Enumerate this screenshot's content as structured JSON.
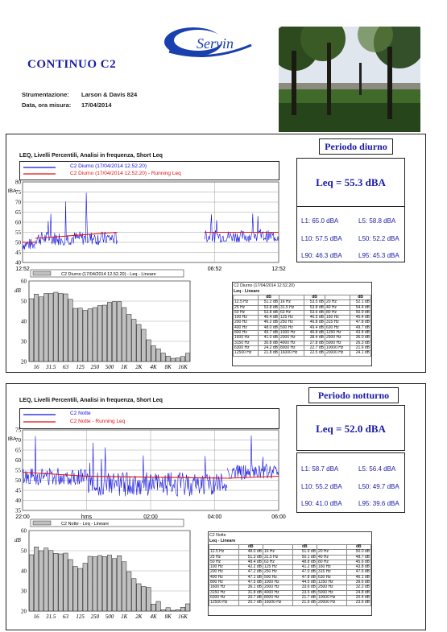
{
  "doc": {
    "title": "CONTINUO C2",
    "instrument_label": "Strumentazione:",
    "instrument_value": "Larson & Davis 824",
    "date_label": "Data, ora misura:",
    "date_value": "17/04/2014",
    "logo_text": "Servin"
  },
  "day": {
    "section_title": "LEQ, Livelli Percentili, Analisi in frequenza, Short Leq",
    "period_label": "Periodo diurno",
    "leq": "Leq = 55.3 dBA",
    "l1": "L1: 65.0 dBA",
    "l5": "L5: 58.8 dBA",
    "l10": "L10: 57.5 dBA",
    "l50": "L50: 52.2 dBA",
    "l90": "L90: 46.3 dBA",
    "l95": "L95: 45.3 dBA",
    "legend1": "C2 Diurno (17/04/2014 12.52.20)",
    "legend2": "C2 Diurno (17/04/2014 12.52.20) - Running Leq",
    "ts_ylabel": "dBA",
    "ts_yticks": [
      "80",
      "75",
      "70",
      "65",
      "60",
      "55",
      "50",
      "45",
      "40"
    ],
    "ts_xticks": [
      "12:52",
      "06:52",
      "12:52"
    ],
    "spec_legend": "C2 Diurno (17/04/2014 12.52.20) - Leq - Lineare",
    "spec_ylabel": "dB",
    "spec_yticks": [
      "60",
      "50",
      "40",
      "30",
      "20"
    ],
    "spec_xticks": [
      "16",
      "31.5",
      "63",
      "125",
      "250",
      "500",
      "1K",
      "2K",
      "4K",
      "8K",
      "16K"
    ],
    "table_title": "C2 Diurno (17/04/2014 12.52.20)",
    "table_sub": "Leq - Lineare",
    "table_rows": [
      [
        "12.5 Hz",
        "51.2 dB",
        "16 Hz",
        "53.5 dB",
        "20 Hz",
        "52.1 dB"
      ],
      [
        "25 Hz",
        "53.8 dB",
        "31.5 Hz",
        "53.8 dB",
        "40 Hz",
        "54.4 dB"
      ],
      [
        "50 Hz",
        "53.8 dB",
        "63 Hz",
        "53.6 dB",
        "80 Hz",
        "50.9 dB"
      ],
      [
        "100 Hz",
        "46.4 dB",
        "125 Hz",
        "46.5 dB",
        "160 Hz",
        "45.4 dB"
      ],
      [
        "200 Hz",
        "46.2 dB",
        "250 Hz",
        "46.8 dB",
        "315 Hz",
        "47.8 dB"
      ],
      [
        "400 Hz",
        "48.0 dB",
        "500 Hz",
        "49.4 dB",
        "630 Hz",
        "49.7 dB"
      ],
      [
        "800 Hz",
        "49.7 dB",
        "1000 Hz",
        "46.8 dB",
        "1250 Hz",
        "43.4 dB"
      ],
      [
        "1600 Hz",
        "41.0 dB",
        "2000 Hz",
        "38.4 dB",
        "2500 Hz",
        "36.0 dB"
      ],
      [
        "3150 Hz",
        "30.8 dB",
        "4000 Hz",
        "27.8 dB",
        "5000 Hz",
        "26.3 dB"
      ],
      [
        "6300 Hz",
        "24.2 dB",
        "8000 Hz",
        "22.7 dB",
        "10000 Hz",
        "21.6 dB"
      ],
      [
        "12500 Hz",
        "21.8 dB",
        "16000 Hz",
        "22.5 dB",
        "20000 Hz",
        "24.1 dB"
      ]
    ]
  },
  "night": {
    "section_title": "LEQ, Livelli Percentili, Analisi in frequenza, Short Leq",
    "period_label": "Periodo notturno",
    "leq": "Leq = 52.0 dBA",
    "l1": "L1: 58.7 dBA",
    "l5": "L5: 56.4 dBA",
    "l10": "L10: 55.2 dBA",
    "l50": "L50: 49.7 dBA",
    "l90": "L90: 41.0 dBA",
    "l95": "L95: 39.6 dBA",
    "legend1": "C2 Notte",
    "legend2": "C2 Notte - Running Leq",
    "ts_ylabel": "dBA",
    "ts_yticks": [
      "75",
      "70",
      "65",
      "60",
      "55",
      "50",
      "45",
      "40",
      "35"
    ],
    "ts_xticks": [
      "22:00",
      "hms",
      "02:00",
      "04:00",
      "06:00"
    ],
    "spec_legend": "C2 Notte - Leq - Lineare",
    "spec_ylabel": "dB",
    "spec_yticks": [
      "60",
      "50",
      "40",
      "30",
      "20"
    ],
    "spec_xticks": [
      "16",
      "31.5",
      "63",
      "125",
      "250",
      "500",
      "1K",
      "2K",
      "4K",
      "8K",
      "16K"
    ],
    "table_title": "C2 Notte",
    "table_sub": "Leq - Lineare",
    "table_rows": [
      [
        "12.5 Hz",
        "48.0 dB",
        "16 Hz",
        "51.9 dB",
        "20 Hz",
        "50.0 dB"
      ],
      [
        "25 Hz",
        "51.3 dB",
        "31.5 Hz",
        "50.1 dB",
        "40 Hz",
        "48.7 dB"
      ],
      [
        "50 Hz",
        "48.4 dB",
        "63 Hz",
        "48.8 dB",
        "80 Hz",
        "45.6 dB"
      ],
      [
        "100 Hz",
        "42.2 dB",
        "125 Hz",
        "41.2 dB",
        "160 Hz",
        "43.8 dB"
      ],
      [
        "200 Hz",
        "47.2 dB",
        "250 Hz",
        "47.0 dB",
        "315 Hz",
        "47.6 dB"
      ],
      [
        "400 Hz",
        "47.1 dB",
        "500 Hz",
        "47.8 dB",
        "630 Hz",
        "46.1 dB"
      ],
      [
        "800 Hz",
        "47.5 dB",
        "1000 Hz",
        "44.5 dB",
        "1250 Hz",
        "39.6 dB"
      ],
      [
        "1600 Hz",
        "36.1 dB",
        "2000 Hz",
        "33.6 dB",
        "2500 Hz",
        "32.2 dB"
      ],
      [
        "3150 Hz",
        "31.8 dB",
        "4000 Hz",
        "23.5 dB",
        "5000 Hz",
        "24.8 dB"
      ],
      [
        "6300 Hz",
        "20.7 dB",
        "8000 Hz",
        "21.7 dB",
        "10000 Hz",
        "20.4 dB"
      ],
      [
        "12500 Hz",
        "20.7 dB",
        "16000 Hz",
        "21.9 dB",
        "20000 Hz",
        "23.6 dB"
      ]
    ]
  },
  "chart_data": [
    {
      "type": "bar",
      "title": "C2 Diurno (17/04/2014 12.52.20) - Leq - Lineare",
      "ylabel": "dB",
      "ylim": [
        20,
        60
      ],
      "categories": [
        "12.5",
        "16",
        "20",
        "25",
        "31.5",
        "40",
        "50",
        "63",
        "80",
        "100",
        "125",
        "160",
        "200",
        "250",
        "315",
        "400",
        "500",
        "630",
        "800",
        "1000",
        "1250",
        "1600",
        "2000",
        "2500",
        "3150",
        "4000",
        "5000",
        "6300",
        "8000",
        "10000",
        "12500",
        "16000",
        "20000"
      ],
      "values": [
        51.2,
        53.5,
        52.1,
        53.8,
        53.8,
        54.4,
        53.8,
        53.6,
        50.9,
        46.4,
        46.5,
        45.4,
        46.2,
        46.8,
        47.8,
        48.0,
        49.4,
        49.7,
        49.7,
        46.8,
        43.4,
        41.0,
        38.4,
        36.0,
        30.8,
        27.8,
        26.3,
        24.2,
        22.7,
        21.6,
        21.8,
        22.5,
        24.1
      ]
    },
    {
      "type": "bar",
      "title": "C2 Notte - Leq - Lineare",
      "ylabel": "dB",
      "ylim": [
        20,
        60
      ],
      "categories": [
        "12.5",
        "16",
        "20",
        "25",
        "31.5",
        "40",
        "50",
        "63",
        "80",
        "100",
        "125",
        "160",
        "200",
        "250",
        "315",
        "400",
        "500",
        "630",
        "800",
        "1000",
        "1250",
        "1600",
        "2000",
        "2500",
        "3150",
        "4000",
        "5000",
        "6300",
        "8000",
        "10000",
        "12500",
        "16000",
        "20000"
      ],
      "values": [
        48.0,
        51.9,
        50.0,
        51.3,
        50.1,
        48.7,
        48.4,
        48.8,
        45.6,
        42.2,
        41.2,
        43.8,
        47.2,
        47.0,
        47.6,
        47.1,
        47.8,
        46.1,
        47.5,
        44.5,
        39.6,
        36.1,
        33.6,
        32.2,
        31.8,
        23.5,
        24.8,
        20.7,
        21.7,
        20.4,
        20.7,
        21.9,
        23.6
      ]
    }
  ],
  "colors": {
    "blue": "#1010e0",
    "red": "#e01010",
    "title": "#1a1aa8",
    "bar": "#c0c0c0"
  }
}
